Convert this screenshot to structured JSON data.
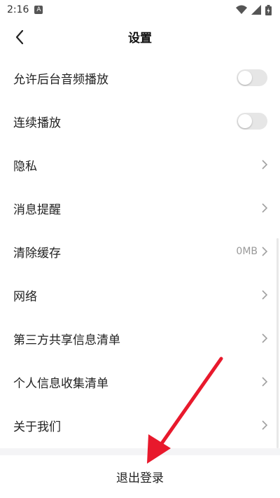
{
  "status_bar": {
    "time": "2:16",
    "notification_icon": "a-letter-icon",
    "wifi_icon": "wifi-icon",
    "signal_icon": "signal-icon",
    "battery_icon": "battery-charging-icon"
  },
  "header": {
    "title": "设置",
    "back_icon": "chevron-left-icon"
  },
  "settings": {
    "items": [
      {
        "label": "允许后台音频播放",
        "type": "toggle",
        "state": "off"
      },
      {
        "label": "连续播放",
        "type": "toggle",
        "state": "off"
      },
      {
        "label": "隐私",
        "type": "link"
      },
      {
        "label": "消息提醒",
        "type": "link"
      },
      {
        "label": "清除缓存",
        "type": "link",
        "value": "0MB"
      },
      {
        "label": "网络",
        "type": "link"
      },
      {
        "label": "第三方共享信息清单",
        "type": "link"
      },
      {
        "label": "个人信息收集清单",
        "type": "link"
      },
      {
        "label": "关于我们",
        "type": "link"
      }
    ]
  },
  "logout": {
    "label": "退出登录"
  },
  "colors": {
    "annotation_arrow": "#e8192c",
    "toggle_off": "#e6e6e6",
    "chevron": "#a0a0a0"
  }
}
